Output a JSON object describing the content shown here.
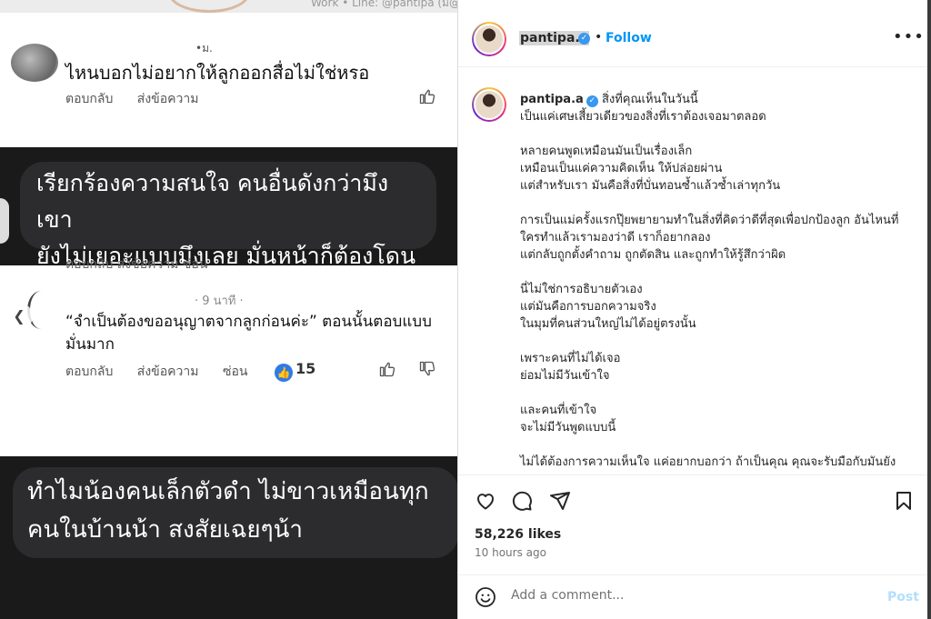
{
  "left_media": {
    "top_strip_text": "Work  • Line: @pantipa (ม@)",
    "comment1": {
      "dot_text": "•ม.",
      "text": "ไหนบอกไม่อยากให้ลูกออกสื่อไม่ใช่หรอ",
      "reply": "ตอบกลับ",
      "send_message": "ส่งข้อความ"
    },
    "bubble1": {
      "line1": "เรียกร้องความสนใจ คนอื่นดังกว่ามึงเขา",
      "line2": "ยังไม่เยอะแบบมึงเลย มั่นหน้าก็ต้องโดน"
    },
    "comment2": {
      "partial_actions": "ตอบกลับ      ส่งข้อความ       ซ่อน",
      "time": "· 9 นาที ·",
      "text": "“จำเป็นต้องขออนุญาตจากลูกก่อนค่ะ” ตอนนั้นตอบแบบมั่นมาก",
      "reply": "ตอบกลับ",
      "send_message": "ส่งข้อความ",
      "hide": "ซ่อน",
      "likes": "15"
    },
    "bubble2": {
      "line1": "ทำไมน้องคนเล็กตัวดำ ไม่ขาวเหมือนทุก",
      "line2": "คนในบ้านน้า สงสัยเฉยๆน้า"
    }
  },
  "post": {
    "header": {
      "username": "pantipa.a",
      "dot": "•",
      "follow_label": "Follow",
      "more_label": "•••"
    },
    "caption": {
      "username": "pantipa.a",
      "first_line": "สิ่งที่คุณเห็นในวันนี้\nเป็นแค่เศษเสี้ยวเดียวของสิ่งที่เราต้องเจอมาตลอด",
      "paragraphs": [
        "หลายคนพูดเหมือนมันเป็นเรื่องเล็ก\nเหมือนเป็นแค่ความคิดเห็น ให้ปล่อยผ่าน\nแต่สำหรับเรา มันคือสิ่งที่บั่นทอนซ้ำแล้วซ้ำเล่าทุกวัน",
        "การเป็นแม่ครั้งแรกปุ๊ยพยายามทำในสิ่งที่คิดว่าดีที่สุดเพื่อปกป้องลูก อันไหนที่ใครทำแล้วเรามองว่าดี เราก็อยากลอง\nแต่กลับถูกตั้งคำถาม ถูกตัดสิน และถูกทำให้รู้สึกว่าผิด",
        "นี่ไม่ใช่การอธิบายตัวเอง\nแต่มันคือการบอกความจริง\nในมุมที่คนส่วนใหญ่ไม่ได้อยู่ตรงนั้น",
        "เพราะคนที่ไม่ได้เจอ\nย่อมไม่มีวันเข้าใจ",
        "และคนที่เข้าใจ\nจะไม่มีวันพูดแบบนี้",
        "ไม่ได้ต้องการความเห็นใจ แค่อยากบอกว่า ถ้าเป็นคุณ คุณจะรับมือกับมันยัง"
      ]
    },
    "likes": "58,226 likes",
    "posted": "10 hours ago",
    "comment_placeholder": "Add a comment...",
    "post_label": "Post"
  }
}
